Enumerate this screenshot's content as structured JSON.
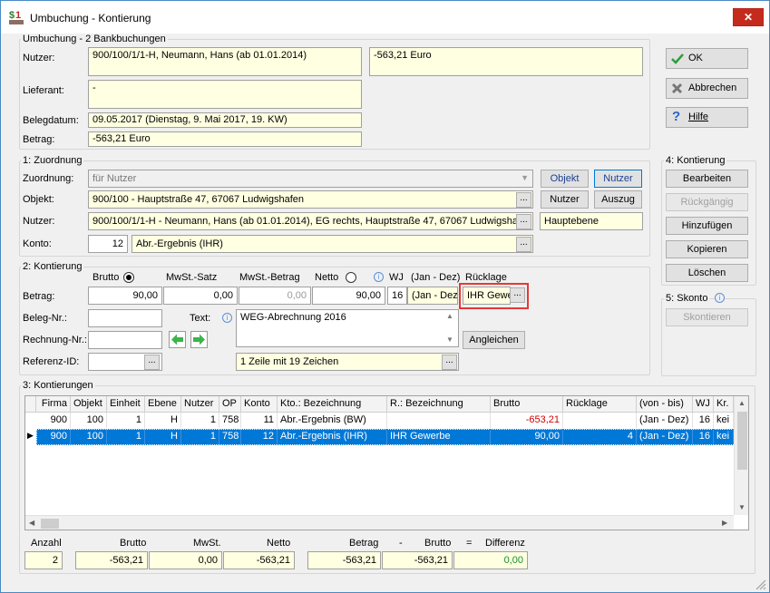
{
  "window": {
    "title": "Umbuchung - Kontierung",
    "close_glyph": "✕",
    "min_glyph": "—",
    "max_glyph": "☐"
  },
  "umbuchung": {
    "group_title": "Umbuchung - 2 Bankbuchungen",
    "nutzer_label": "Nutzer:",
    "nutzer_value": "900/100/1/1-H,  Neumann, Hans  (ab 01.01.2014)",
    "amount_value": "-563,21  Euro",
    "lieferant_label": "Lieferant:",
    "lieferant_value": "-",
    "belegdatum_label": "Belegdatum:",
    "belegdatum_value": "09.05.2017  (Dienstag,  9. Mai 2017,  19. KW)",
    "betrag_label": "Betrag:",
    "betrag_value": "-563,21  Euro"
  },
  "buttons": {
    "ok": "OK",
    "abbrechen": "Abbrechen",
    "hilfe": "Hilfe"
  },
  "zuordnung": {
    "group_title": "1: Zuordnung",
    "zuordnung_label": "Zuordnung:",
    "zuordnung_value": "für Nutzer",
    "objekt_btn": "Objekt",
    "nutzer_btn": "Nutzer",
    "objekt_label": "Objekt:",
    "objekt_value": "900/100 - Hauptstraße 47, 67067 Ludwigshafen",
    "nutzer_btn2": "Nutzer",
    "auszug_btn": "Auszug",
    "nutzer_label": "Nutzer:",
    "nutzer_value": "900/100/1/1-H - Neumann, Hans  (ab 01.01.2014), EG rechts, Hauptstraße 47, 67067 Ludwigshaf",
    "hauptebene_value": "Hauptebene",
    "konto_label": "Konto:",
    "konto_number": "12",
    "konto_value": "Abr.-Ergebnis (IHR)"
  },
  "kontierung_side": {
    "group_title": "4: Kontierung",
    "bearbeiten": "Bearbeiten",
    "rueckgaengig": "Rückgängig",
    "hinzufuegen": "Hinzufügen",
    "kopieren": "Kopieren",
    "loeschen": "Löschen"
  },
  "skonto": {
    "group_title": "5: Skonto",
    "skontieren": "Skontieren"
  },
  "kontierung": {
    "group_title": "2: Kontierung",
    "brutto_label": "Brutto",
    "mwst_satz_label": "MwSt.-Satz",
    "mwst_betrag_label": "MwSt.-Betrag",
    "netto_label": "Netto",
    "wj_label": "WJ",
    "jan_dez_label": "(Jan - Dez)",
    "ruecklage_label": "Rücklage",
    "betrag_label": "Betrag:",
    "brutto_value": "90,00",
    "mwst_satz_value": "0,00",
    "mwst_betrag_value": "0,00",
    "netto_value": "90,00",
    "wj_value": "16",
    "period_value": "(Jan - Dez)",
    "ruecklage_value": "IHR Gewe",
    "beleg_label": "Beleg-Nr.:",
    "text_label": "Text:",
    "text_value": "WEG-Abrechnung 2016",
    "rechnung_label": "Rechnung-Nr.:",
    "angleichen": "Angleichen",
    "referenz_label": "Referenz-ID:",
    "text_info": "1 Zeile mit 19 Zeichen"
  },
  "kontierungen": {
    "group_title": "3: Kontierungen",
    "columns": [
      "Firma",
      "Objekt",
      "Einheit",
      "Ebene",
      "Nutzer",
      "OP",
      "Konto",
      "Kto.: Bezeichnung",
      "R.: Bezeichnung",
      "Brutto",
      "Rücklage",
      "(von - bis)",
      "WJ",
      "Kr."
    ],
    "rows": [
      [
        "900",
        "100",
        "1",
        "H",
        "1",
        "758",
        "11",
        "Abr.-Ergebnis (BW)",
        "",
        "-653,21",
        "",
        "(Jan - Dez)",
        "16",
        "kei"
      ],
      [
        "900",
        "100",
        "1",
        "H",
        "1",
        "758",
        "12",
        "Abr.-Ergebnis (IHR)",
        "IHR Gewerbe",
        "90,00",
        "4",
        "(Jan - Dez)",
        "16",
        "kei"
      ]
    ]
  },
  "summary": {
    "anzahl_label": "Anzahl",
    "brutto_label": "Brutto",
    "mwst_label": "MwSt.",
    "netto_label": "Netto",
    "betrag_label": "Betrag",
    "minus": "-",
    "brutto2_label": "Brutto",
    "equals": "=",
    "differenz_label": "Differenz",
    "anzahl_value": "2",
    "brutto_value": "-563,21",
    "mwst_value": "0,00",
    "netto_value": "-563,21",
    "betrag_value": "-563,21",
    "brutto2_value": "-563,21",
    "differenz_value": "0,00"
  },
  "colors": {
    "selection": "#0078d7",
    "highlight_box": "#e53935",
    "negative": "#d00000",
    "field_bg": "#ffffe1"
  }
}
